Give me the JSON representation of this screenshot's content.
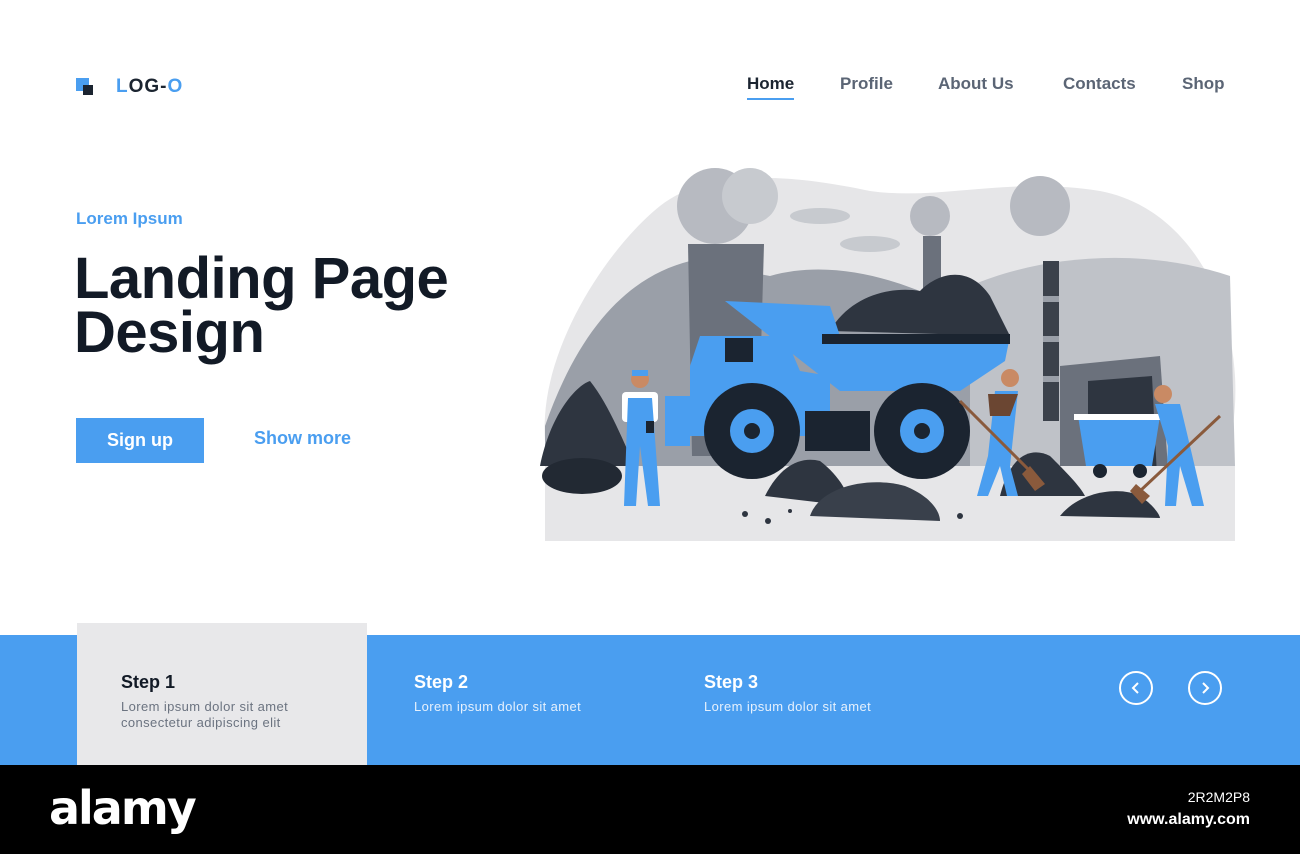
{
  "header": {
    "logo": {
      "first": "L",
      "middle": "OG-",
      "last": "O"
    },
    "nav": [
      {
        "label": "Home",
        "active": true
      },
      {
        "label": "Profile",
        "active": false
      },
      {
        "label": "About Us",
        "active": false
      },
      {
        "label": "Contacts",
        "active": false
      },
      {
        "label": "Shop",
        "active": false
      }
    ]
  },
  "hero": {
    "kicker": "Lorem Ipsum",
    "title": "Landing Page Design",
    "primary_button": "Sign up",
    "secondary_button": "Show more",
    "illustration_icon": "coal-mining-illustration"
  },
  "steps": [
    {
      "title": "Step 1",
      "text": "Lorem ipsum dolor sit amet consectetur adipiscing elit",
      "active": true
    },
    {
      "title": "Step 2",
      "text": "Lorem ipsum dolor sit amet",
      "active": false
    },
    {
      "title": "Step 3",
      "text": "Lorem ipsum dolor sit amet",
      "active": false
    }
  ],
  "carousel": {
    "prev_icon": "chevron-left-icon",
    "next_icon": "chevron-right-icon"
  },
  "watermark": {
    "brand": "alamy",
    "image_id": "2R2M2P8",
    "url": "www.alamy.com"
  },
  "colors": {
    "accent": "#4a9ef0",
    "dark": "#121a26",
    "muted": "#5b6575",
    "panel": "#e8e8ea"
  }
}
